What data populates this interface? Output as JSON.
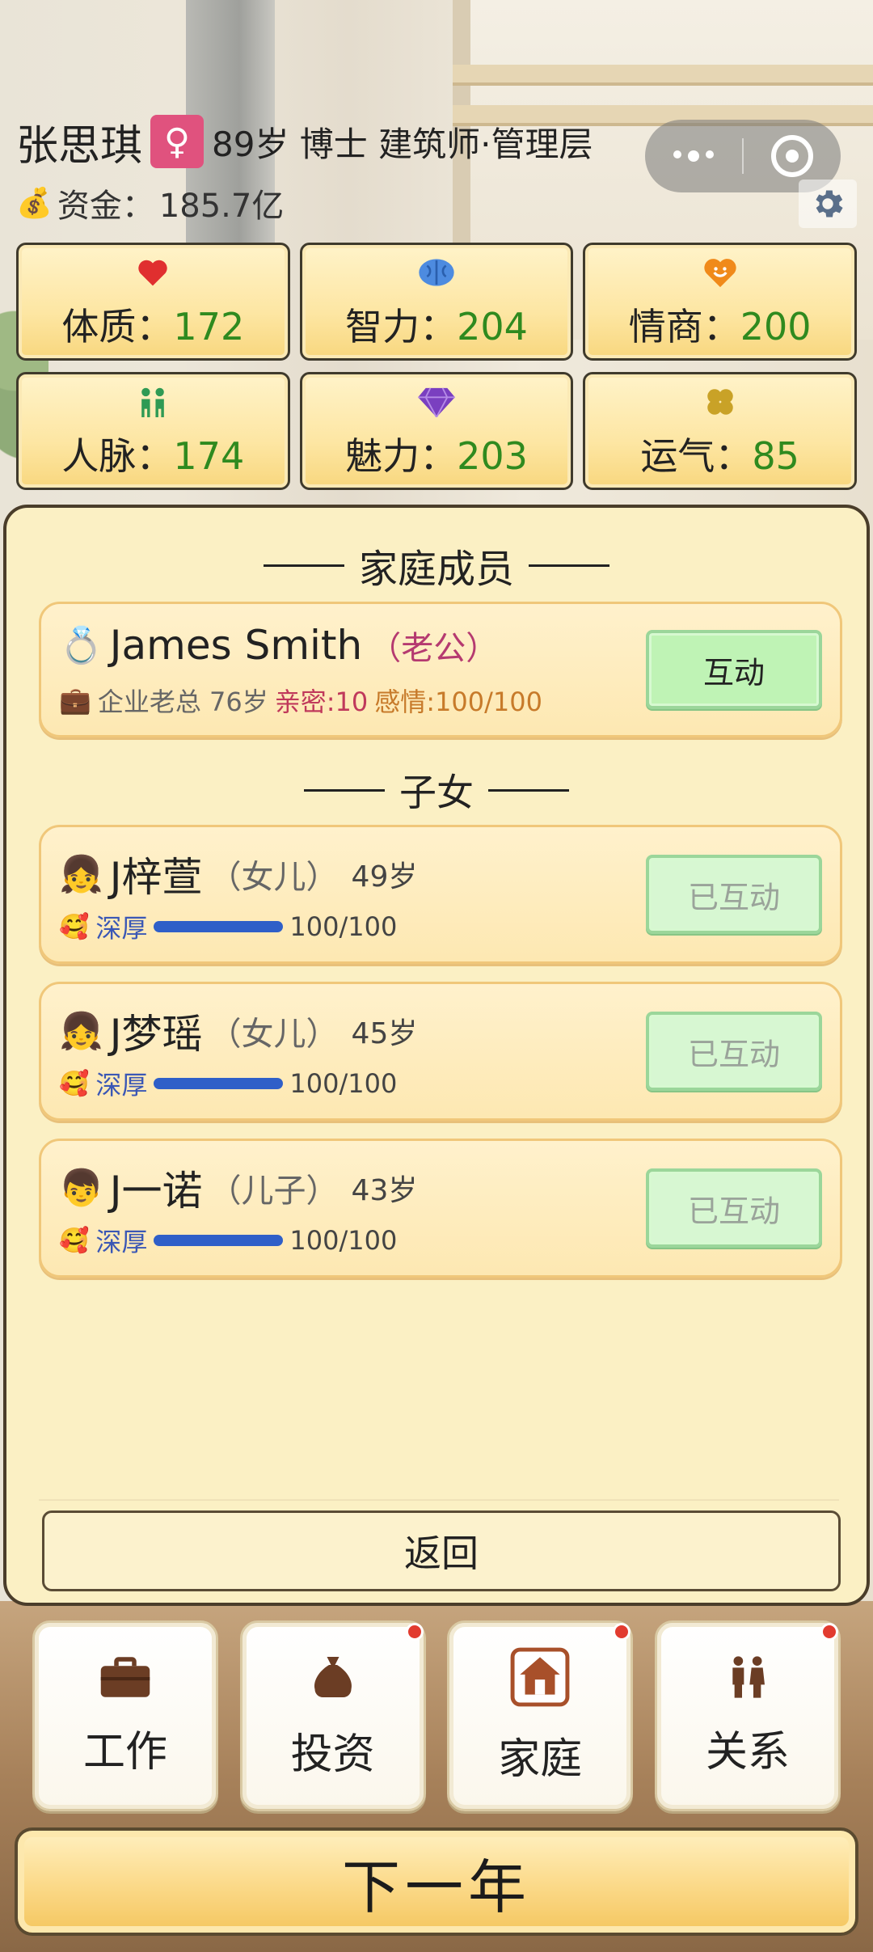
{
  "player": {
    "name": "张思琪",
    "gender_symbol": "♀",
    "meta": "89岁 博士 建筑师·管理层",
    "funds_label": "资金：",
    "funds_value": "185.7亿"
  },
  "stats": [
    {
      "icon": "heart-icon",
      "label": "体质：",
      "value": "172",
      "color": "#e02f2f"
    },
    {
      "icon": "brain-icon",
      "label": "智力：",
      "value": "204",
      "color": "#3a7bd5"
    },
    {
      "icon": "smile-heart-icon",
      "label": "情商：",
      "value": "200",
      "color": "#f08a1a"
    },
    {
      "icon": "people-icon",
      "label": "人脉：",
      "value": "174",
      "color": "#2f9a54"
    },
    {
      "icon": "diamond-icon",
      "label": "魅力：",
      "value": "203",
      "color": "#7a3fc0"
    },
    {
      "icon": "clover-icon",
      "label": "运气：",
      "value": "85",
      "color": "#c9a227"
    }
  ],
  "family": {
    "title": "家庭成员",
    "spouse": {
      "name": "James Smith",
      "relation": "（老公）",
      "job_age": "企业老总 76岁",
      "intimacy": "亲密:10",
      "feeling": "感情:100/100",
      "button": "互动"
    },
    "children_title": "子女",
    "children": [
      {
        "name": "J梓萱",
        "relation": "（女儿）",
        "age": "49岁",
        "bond": "深厚",
        "progress": "100/100",
        "button": "已互动"
      },
      {
        "name": "J梦瑶",
        "relation": "（女儿）",
        "age": "45岁",
        "bond": "深厚",
        "progress": "100/100",
        "button": "已互动"
      },
      {
        "name": "J一诺",
        "relation": "（儿子）",
        "age": "43岁",
        "bond": "深厚",
        "progress": "100/100",
        "button": "已互动"
      }
    ],
    "back": "返回"
  },
  "nav": [
    {
      "icon": "briefcase-icon",
      "label": "工作",
      "badge": false
    },
    {
      "icon": "money-bag-icon",
      "label": "投资",
      "badge": true
    },
    {
      "icon": "house-icon",
      "label": "家庭",
      "badge": true
    },
    {
      "icon": "couple-icon",
      "label": "关系",
      "badge": true
    }
  ],
  "next_year": "下一年"
}
